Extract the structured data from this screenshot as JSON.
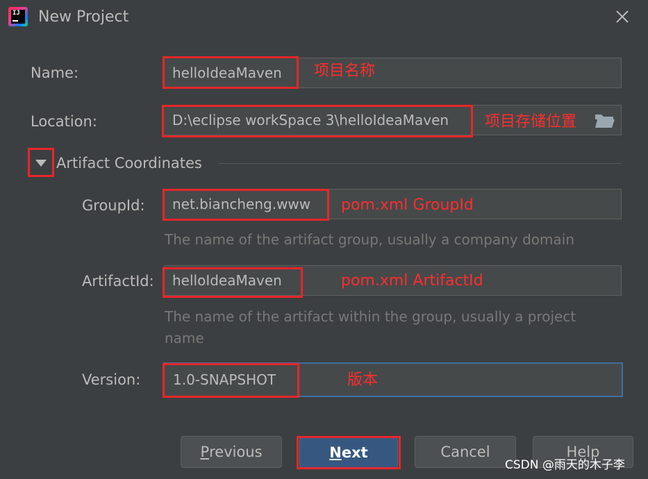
{
  "window": {
    "title": "New Project",
    "icon_text": "IJ"
  },
  "form": {
    "name": {
      "label": "Name:",
      "value": "helloIdeaMaven",
      "annotation": "项目名称"
    },
    "location": {
      "label": "Location:",
      "value": "D:\\eclipse workSpace 3\\helloIdeaMaven",
      "annotation": "项目存储位置"
    },
    "section": {
      "title": "Artifact Coordinates"
    },
    "group_id": {
      "label": "GroupId:",
      "value": "net.biancheng.www",
      "annotation": "pom.xml GroupId",
      "hint": "The name of the artifact group, usually a company domain"
    },
    "artifact_id": {
      "label": "ArtifactId:",
      "value": "helloIdeaMaven",
      "annotation": "pom.xml ArtifactId",
      "hint_line1": "The name of the artifact within the group, usually a project",
      "hint_line2": "name"
    },
    "version": {
      "label": "Version:",
      "value": "1.0-SNAPSHOT",
      "annotation": "版本"
    }
  },
  "buttons": {
    "previous": {
      "mnemonic": "P",
      "rest": "revious"
    },
    "next": {
      "mnemonic": "N",
      "rest": "ext"
    },
    "cancel": {
      "label": "Cancel"
    },
    "help": {
      "label": "Help"
    }
  },
  "watermark": "CSDN @雨天的木子李",
  "colors": {
    "background": "#3c3f41",
    "field": "#45494a",
    "primary_button": "#365880",
    "annotation_red": "#e8262a",
    "focus_border": "#3d6fa5"
  }
}
